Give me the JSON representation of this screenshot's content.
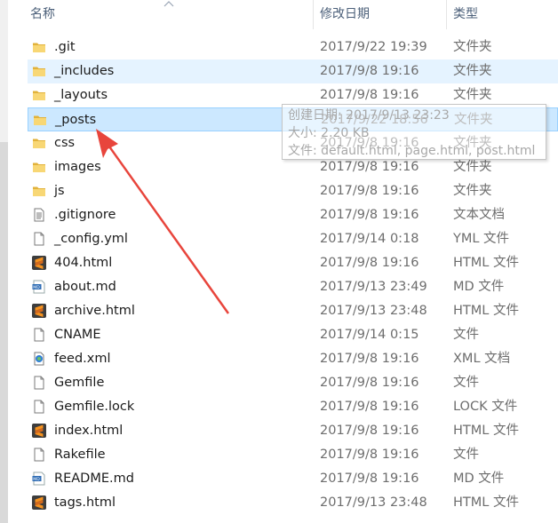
{
  "header": {
    "name": "名称",
    "date": "修改日期",
    "type": "类型"
  },
  "files": [
    {
      "name": ".git",
      "date": "2017/9/22 19:39",
      "type": "文件夹",
      "icon": "folder-icon"
    },
    {
      "name": "_includes",
      "date": "2017/9/8 19:16",
      "type": "文件夹",
      "icon": "folder-icon"
    },
    {
      "name": "_layouts",
      "date": "2017/9/8 19:16",
      "type": "文件夹",
      "icon": "folder-icon"
    },
    {
      "name": "_posts",
      "date": "2017/9/22 18:56",
      "type": "文件夹",
      "icon": "folder-icon"
    },
    {
      "name": "css",
      "date": "2017/9/8 19:16",
      "type": "文件夹",
      "icon": "folder-icon"
    },
    {
      "name": "images",
      "date": "2017/9/8 19:16",
      "type": "文件夹",
      "icon": "folder-icon"
    },
    {
      "name": "js",
      "date": "2017/9/8 19:16",
      "type": "文件夹",
      "icon": "folder-icon"
    },
    {
      "name": ".gitignore",
      "date": "2017/9/8 19:16",
      "type": "文本文档",
      "icon": "text-file-icon"
    },
    {
      "name": "_config.yml",
      "date": "2017/9/14 0:18",
      "type": "YML 文件",
      "icon": "blank-file-icon"
    },
    {
      "name": "404.html",
      "date": "2017/9/8 19:16",
      "type": "HTML 文件",
      "icon": "sublime-icon"
    },
    {
      "name": "about.md",
      "date": "2017/9/13 23:49",
      "type": "MD 文件",
      "icon": "markdown-icon"
    },
    {
      "name": "archive.html",
      "date": "2017/9/13 23:48",
      "type": "HTML 文件",
      "icon": "sublime-icon"
    },
    {
      "name": "CNAME",
      "date": "2017/9/14 0:15",
      "type": "文件",
      "icon": "blank-file-icon"
    },
    {
      "name": "feed.xml",
      "date": "2017/9/8 19:16",
      "type": "XML 文档",
      "icon": "xml-icon"
    },
    {
      "name": "Gemfile",
      "date": "2017/9/8 19:16",
      "type": "文件",
      "icon": "blank-file-icon"
    },
    {
      "name": "Gemfile.lock",
      "date": "2017/9/8 19:16",
      "type": "LOCK 文件",
      "icon": "blank-file-icon"
    },
    {
      "name": "index.html",
      "date": "2017/9/8 19:16",
      "type": "HTML 文件",
      "icon": "sublime-icon"
    },
    {
      "name": "Rakefile",
      "date": "2017/9/8 19:16",
      "type": "文件",
      "icon": "blank-file-icon"
    },
    {
      "name": "README.md",
      "date": "2017/9/8 19:16",
      "type": "MD 文件",
      "icon": "markdown-icon"
    },
    {
      "name": "tags.html",
      "date": "2017/9/13 23:48",
      "type": "HTML 文件",
      "icon": "sublime-icon"
    }
  ],
  "tooltip": {
    "created": "创建日期: 2017/9/13 23:23",
    "size": "大小: 2.20 KB",
    "files": "文件: default.html, page.html, post.html"
  },
  "colors": {
    "hover": "#e5f3ff",
    "selected": "#cce8ff",
    "arrow": "#e8453c",
    "folder": "#f8d775"
  }
}
